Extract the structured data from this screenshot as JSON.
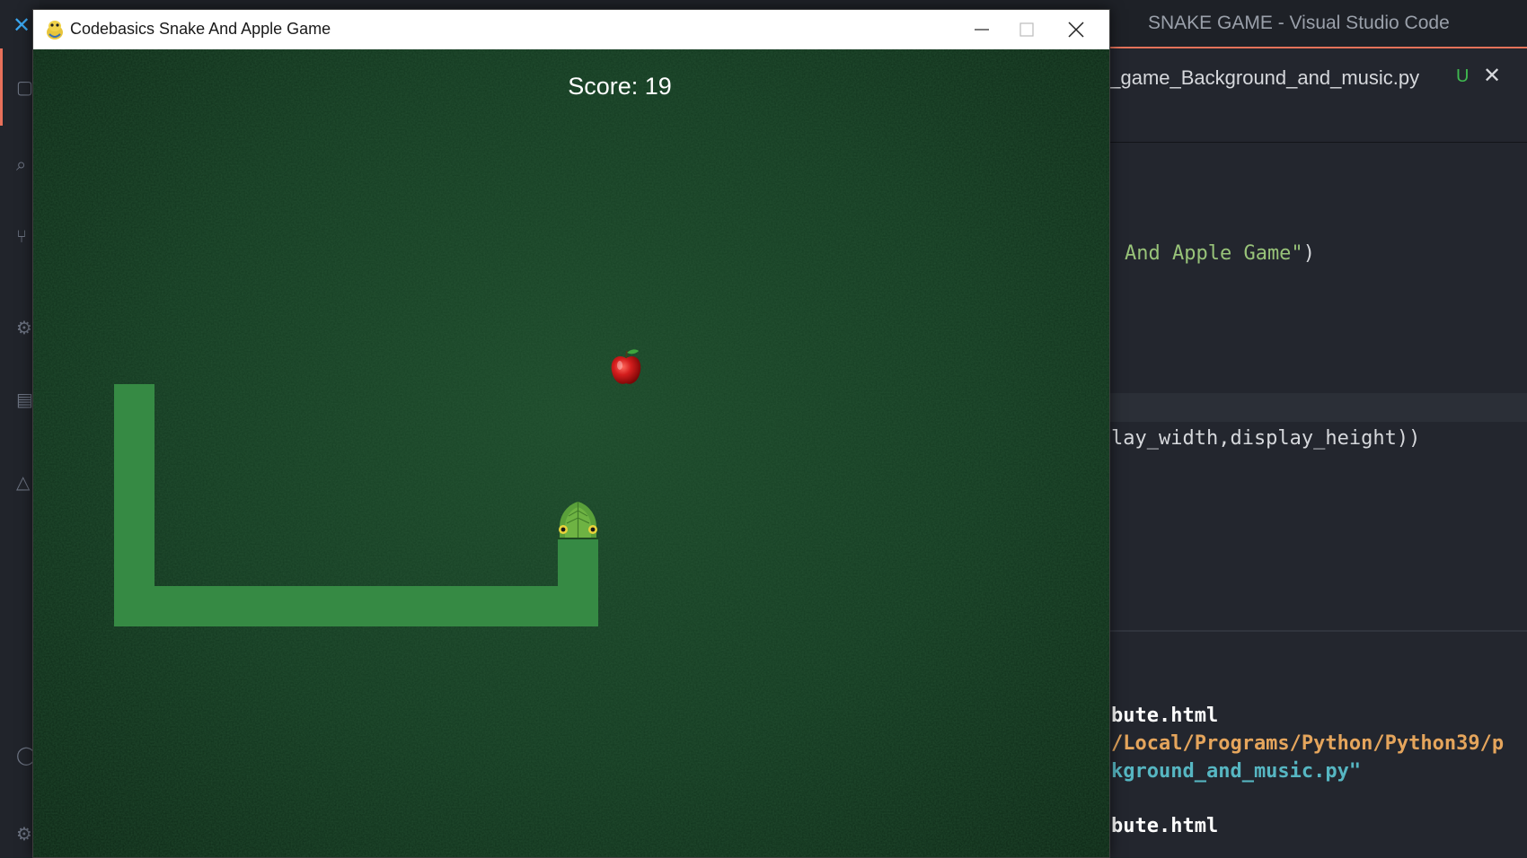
{
  "vscode": {
    "window_title": "SNAKE GAME - Visual Studio Code",
    "tab": {
      "label": "ke_game_Background_and_music.py",
      "status": "U",
      "close_icon": "close-icon"
    },
    "code_lines": [
      {
        "text_plain": "",
        "text_string": "And Apple Game\"",
        "text_tail": ")"
      },
      {
        "text_plain": "lay_width,display_height))",
        "text_string": "",
        "text_tail": ""
      }
    ],
    "terminal_lines": [
      {
        "text": "bute.html",
        "color": "#ffffff"
      },
      {
        "text": "/Local/Programs/Python/Python39/p",
        "color": "#e5a55c"
      },
      {
        "text": "kground_and_music.py\"",
        "color": "#56b6c2"
      },
      {
        "text": "bute.html",
        "color": "#ffffff"
      }
    ],
    "accent_color": "#e5735a"
  },
  "game_window": {
    "title": "Codebasics Snake And Apple Game",
    "app_icon": "pygame-snake-icon",
    "buttons": {
      "minimize": "minimize-icon",
      "maximize": "maximize-icon",
      "close": "close-icon"
    },
    "score_label": "Score: 19",
    "score_value": 19,
    "apple": {
      "icon": "apple-icon",
      "color": "#d41d1d"
    },
    "snake": {
      "length_segments": 19,
      "direction": "up",
      "body_color": "#368a44",
      "head_icon": "snake-head-icon"
    },
    "background_color": "#143a21"
  }
}
